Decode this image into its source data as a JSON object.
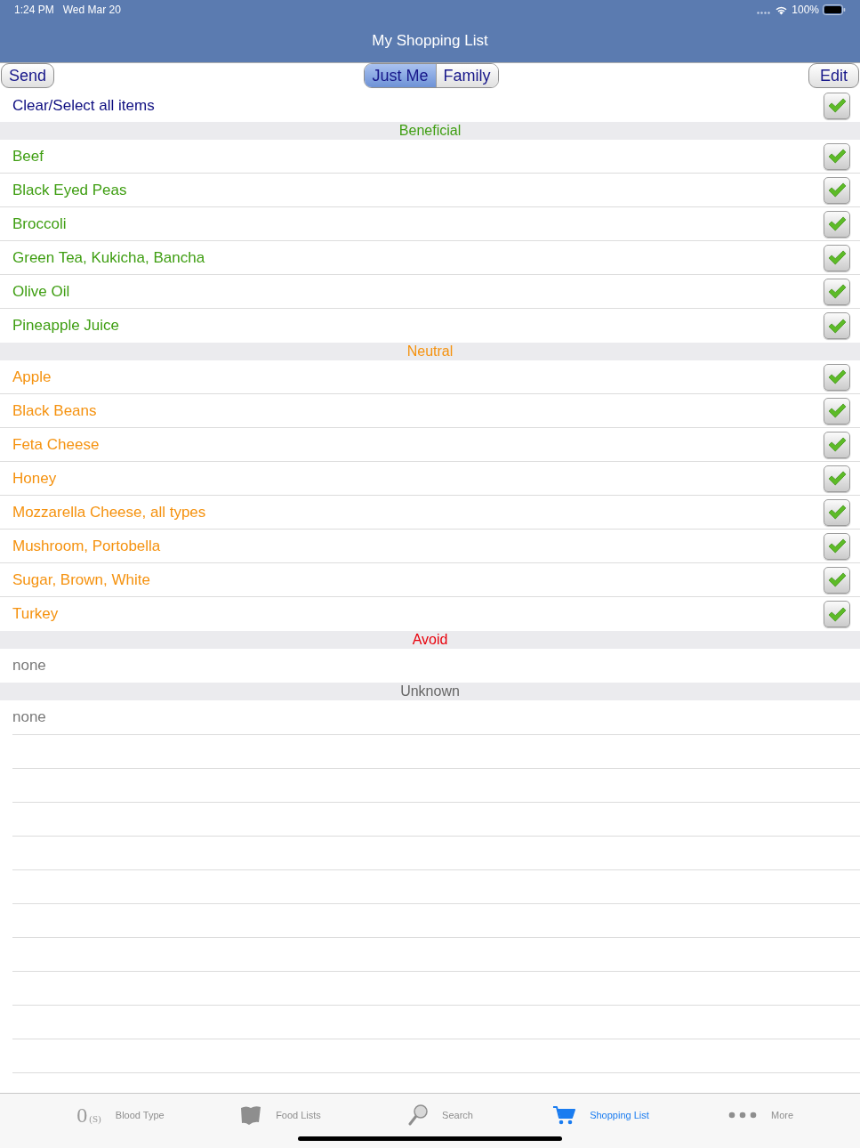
{
  "status_bar": {
    "time": "1:24 PM",
    "date": "Wed Mar 20",
    "battery": "100%"
  },
  "nav_bar": {
    "title": "My Shopping List"
  },
  "toolbar": {
    "left_button": "Send",
    "segments": [
      {
        "label": "Just Me",
        "selected": true
      },
      {
        "label": "Family",
        "selected": false
      }
    ],
    "right_button": "Edit"
  },
  "select_all": {
    "label": "Clear/Select all items",
    "checked": true
  },
  "sections": [
    {
      "title": "Beneficial",
      "color": "#3f9e12",
      "items": [
        {
          "name": "Beef",
          "checked": true
        },
        {
          "name": "Black Eyed Peas",
          "checked": true
        },
        {
          "name": "Broccoli",
          "checked": true
        },
        {
          "name": "Green Tea, Kukicha, Bancha",
          "checked": true
        },
        {
          "name": "Olive Oil",
          "checked": true
        },
        {
          "name": "Pineapple Juice",
          "checked": true
        }
      ]
    },
    {
      "title": "Neutral",
      "color": "#f5920f",
      "items": [
        {
          "name": "Apple",
          "checked": true
        },
        {
          "name": "Black Beans",
          "checked": true
        },
        {
          "name": "Feta Cheese",
          "checked": true
        },
        {
          "name": "Honey",
          "checked": true
        },
        {
          "name": "Mozzarella Cheese, all types",
          "checked": true
        },
        {
          "name": "Mushroom, Portobella",
          "checked": true
        },
        {
          "name": "Sugar, Brown, White",
          "checked": true
        },
        {
          "name": "Turkey",
          "checked": true
        }
      ]
    },
    {
      "title": "Avoid",
      "color": "#e8000b",
      "empty_text": "none"
    },
    {
      "title": "Unknown",
      "color": "#666666",
      "empty_text": "none"
    }
  ],
  "tab_bar": [
    {
      "label": "Blood Type",
      "kind": "blood_type",
      "icon_text": "0",
      "icon_subtext": "(S)",
      "selected": false
    },
    {
      "label": "Food Lists",
      "kind": "food_lists",
      "selected": false
    },
    {
      "label": "Search",
      "kind": "search",
      "selected": false
    },
    {
      "label": "Shopping List",
      "kind": "cart",
      "selected": true
    },
    {
      "label": "More",
      "kind": "more",
      "selected": false
    }
  ]
}
